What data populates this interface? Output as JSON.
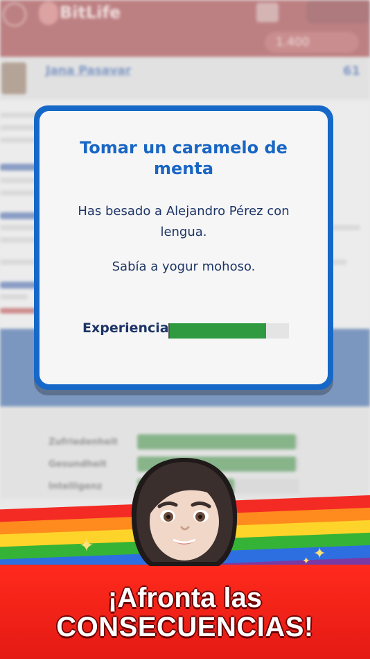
{
  "app": {
    "logo_text": "BitLife",
    "money": "1.400"
  },
  "profile": {
    "name": "Jana Pasavar",
    "age": "61"
  },
  "dialog": {
    "title": "Tomar un caramelo de menta",
    "message_1": "Has besado a Alejandro Pérez con lengua.",
    "message_2": "Sabía a yogur mohoso.",
    "stat_label": "Experiencia",
    "stat_value": 0.81
  },
  "background_stats": [
    {
      "label": "Zufriedenheit",
      "value": 0.98
    },
    {
      "label": "Gesundheit",
      "value": 0.98
    },
    {
      "label": "Intelligenz",
      "value": 0.6
    }
  ],
  "promo": {
    "line1": "¡Afronta las",
    "line2": "CONSECUENCIAS!"
  },
  "colors": {
    "dialog_border": "#1668c8",
    "title_blue": "#1966c4",
    "text_navy": "#1d3566",
    "xp_green": "#2f9a3f",
    "banner_red": "#ff2a1c"
  },
  "icons": [
    "menu-icon",
    "trophy-icon",
    "sparkle-icon",
    "avatar-icon"
  ]
}
